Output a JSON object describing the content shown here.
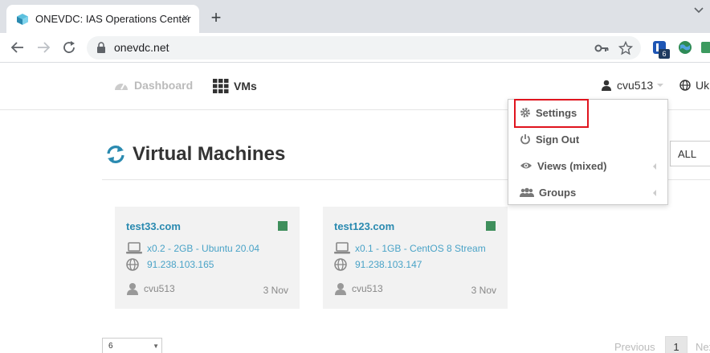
{
  "browser": {
    "tab_title": "ONEVDC: IAS Operations Center",
    "close_glyph": "×",
    "new_tab_glyph": "+",
    "url": "onevdc.net",
    "extension_badge": "6"
  },
  "nav": {
    "dashboard_label": "Dashboard",
    "vms_label": "VMs",
    "user_label": "cvu513",
    "lang_label": "Uk"
  },
  "page": {
    "title": "Virtual Machines",
    "filter_value": "ALL"
  },
  "vms": [
    {
      "name": "test33.com",
      "spec": "x0.2 - 2GB - Ubuntu 20.04",
      "ip": "91.238.103.165",
      "owner": "cvu513",
      "date": "3 Nov",
      "status_color": "#3f8f5c"
    },
    {
      "name": "test123.com",
      "spec": "x0.1 - 1GB - CentOS 8 Stream",
      "ip": "91.238.103.147",
      "owner": "cvu513",
      "date": "3 Nov",
      "status_color": "#3f8f5c"
    }
  ],
  "menu": {
    "items": [
      {
        "label": "Settings",
        "icon": "gear-icon"
      },
      {
        "label": "Sign Out",
        "icon": "power-icon"
      },
      {
        "label": "Views (mixed)",
        "icon": "eye-icon"
      },
      {
        "label": "Groups",
        "icon": "users-icon"
      }
    ],
    "highlight_color": "#e0141e"
  },
  "pagination": {
    "page_size": "6",
    "previous_label": "Previous",
    "current_page": "1",
    "next_label": "Next"
  },
  "colors": {
    "accent": "#2a8ab0",
    "link": "#4aa3c7",
    "status": "#3f8f5c"
  }
}
